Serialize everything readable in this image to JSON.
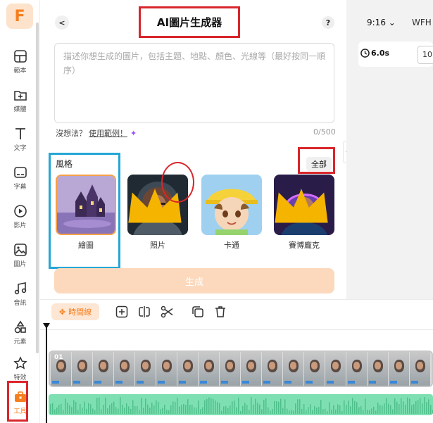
{
  "app": {
    "logo_letter": "F"
  },
  "rail": {
    "items": [
      {
        "label": "範本",
        "icon": "template-icon"
      },
      {
        "label": "媒體",
        "icon": "media-icon"
      },
      {
        "label": "文字",
        "icon": "text-icon"
      },
      {
        "label": "字幕",
        "icon": "subtitle-icon"
      },
      {
        "label": "影片",
        "icon": "video-icon"
      },
      {
        "label": "圖片",
        "icon": "image-icon"
      },
      {
        "label": "音訊",
        "icon": "audio-icon"
      },
      {
        "label": "元素",
        "icon": "element-icon"
      },
      {
        "label": "特效",
        "icon": "effect-icon"
      },
      {
        "label": "工具",
        "icon": "tools-icon"
      }
    ]
  },
  "panel": {
    "title": "AI圖片生成器",
    "help": "?",
    "prompt_placeholder": "描述你想生成的圖片，包括主題、地點、顏色、光線等（最好按同一順序）",
    "hint_prefix": "沒想法？",
    "hint_link": "使用範例！",
    "counter": "0/500",
    "style_title": "風格",
    "all_button": "全部",
    "styles": [
      {
        "label": "繪圖",
        "selected": true,
        "premium": false
      },
      {
        "label": "照片",
        "selected": false,
        "premium": true
      },
      {
        "label": "卡通",
        "selected": false,
        "premium": false
      },
      {
        "label": "賽博龐克",
        "selected": false,
        "premium": true
      }
    ],
    "generate_button": "生成"
  },
  "topbar": {
    "ratio": "9:16",
    "wfh": "WFH",
    "duration": "6.0s",
    "size_field": "10"
  },
  "timeline": {
    "button": "時間線",
    "clip_label": "01",
    "frame_count": 18
  },
  "colors": {
    "accent": "#f57f1e",
    "annotation_red": "#d9262b",
    "annotation_blue": "#24a6d6",
    "audio_track": "#7ee0b2",
    "generate_disabled": "#fcd9bd"
  }
}
